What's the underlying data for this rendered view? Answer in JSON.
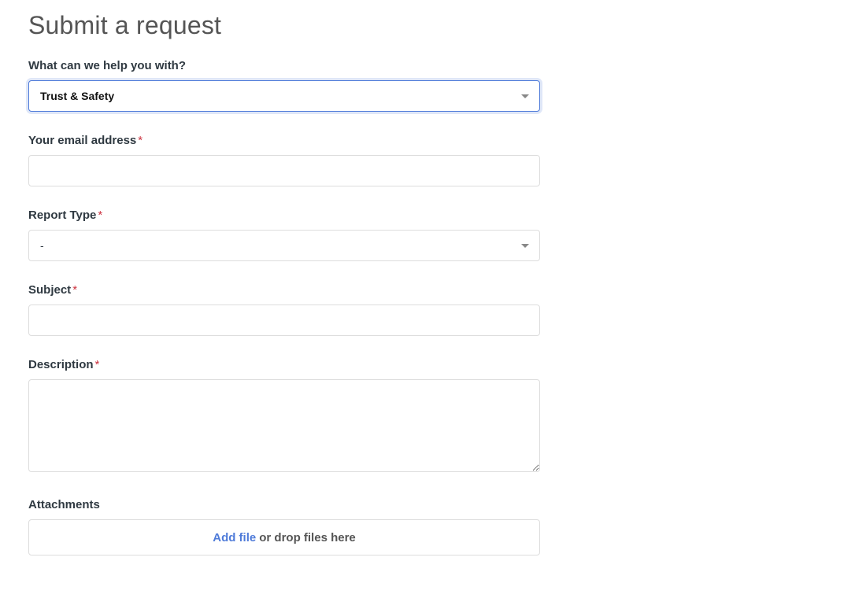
{
  "page": {
    "title": "Submit a request"
  },
  "form": {
    "help_topic": {
      "label": "What can we help you with?",
      "required": false,
      "value": "Trust & Safety"
    },
    "email": {
      "label": "Your email address",
      "required": true,
      "value": ""
    },
    "report_type": {
      "label": "Report Type",
      "required": true,
      "value": "-"
    },
    "subject": {
      "label": "Subject",
      "required": true,
      "value": ""
    },
    "description": {
      "label": "Description",
      "required": true,
      "value": ""
    },
    "attachments": {
      "label": "Attachments",
      "add_file_text": "Add file",
      "drop_text": "or drop files here"
    },
    "required_marker": "*"
  }
}
